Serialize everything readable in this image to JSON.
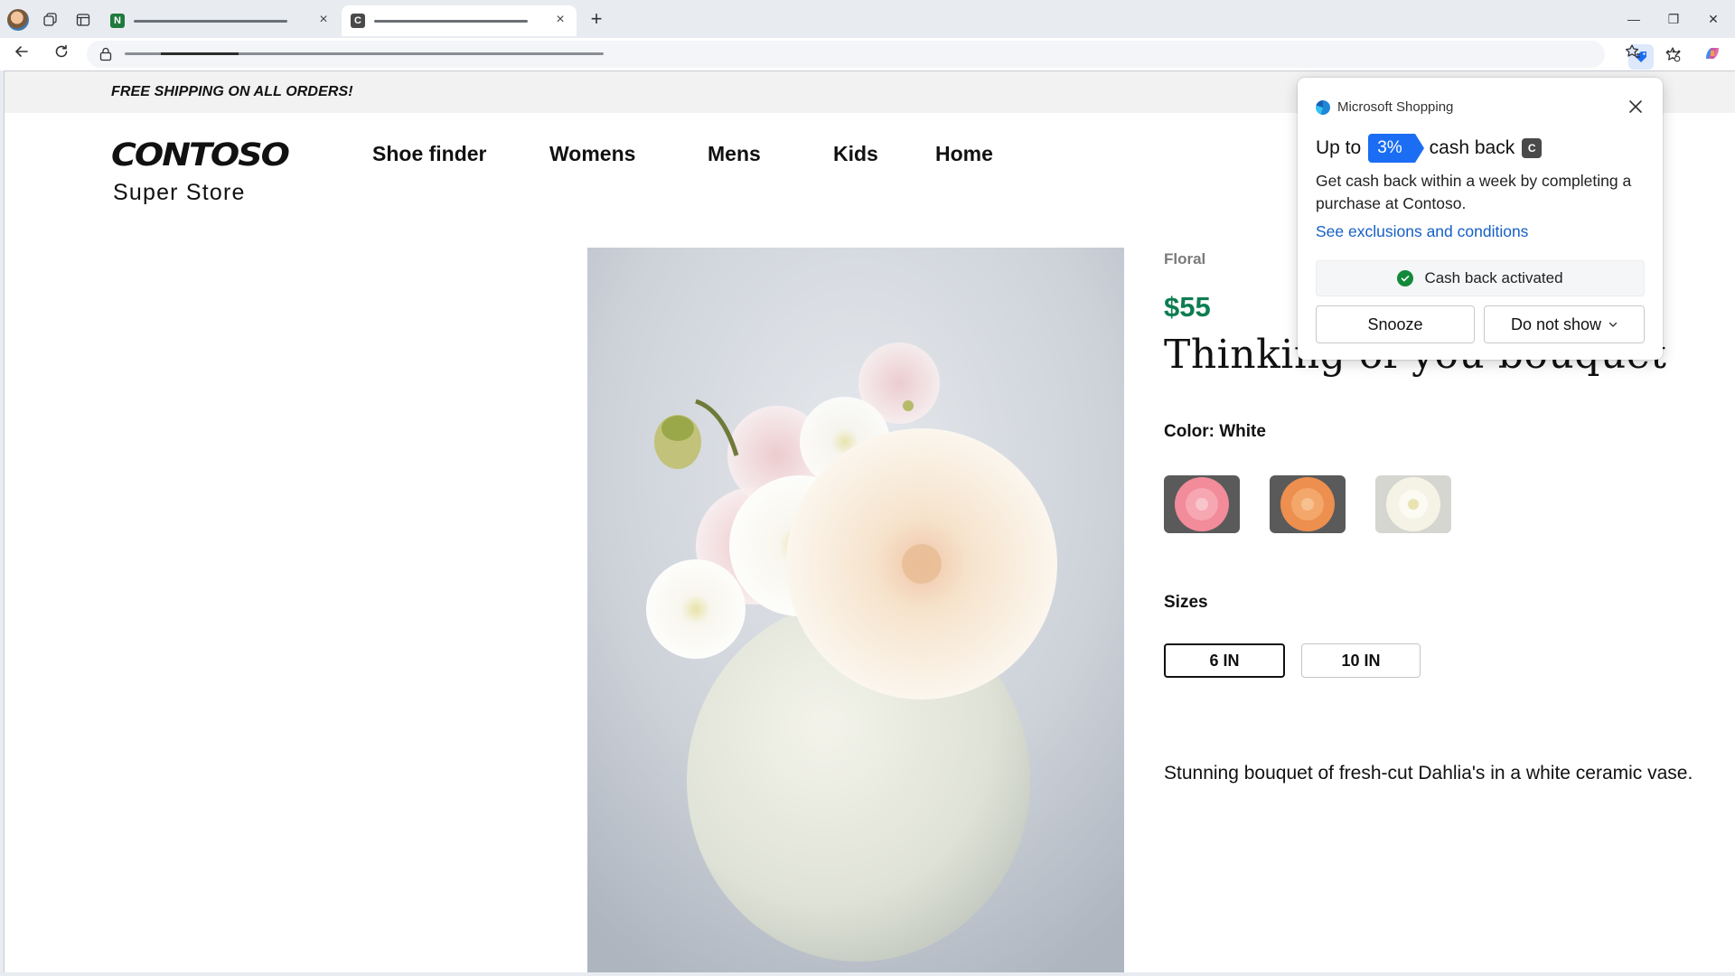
{
  "browser": {
    "tabs": [
      {
        "favicon": "N",
        "favicon_color": "#1f7a3e",
        "close": "×"
      },
      {
        "favicon": "C",
        "favicon_color": "#4a4a4a",
        "close": "×"
      }
    ],
    "new_tab": "+",
    "window_controls": {
      "minimize": "—",
      "restore": "❐",
      "close": "✕"
    }
  },
  "promo": {
    "text": "FREE SHIPPING ON ALL ORDERS!"
  },
  "logo": {
    "brand": "CONTOSO",
    "sub": "Super Store"
  },
  "nav": [
    "Shoe finder",
    "Womens",
    "Mens",
    "Kids",
    "Home"
  ],
  "product": {
    "category": "Floral",
    "price": "$55",
    "title": "Thinking of you bouquet",
    "color_label": "Color: White",
    "sizes_label": "Sizes",
    "sizes": [
      "6 IN",
      "10 IN"
    ],
    "selected_size": "6 IN",
    "description": "Stunning bouquet of fresh-cut Dahlia's in a white ceramic vase."
  },
  "popup": {
    "header": "Microsoft Shopping",
    "up_to": "Up to",
    "percent": "3%",
    "cash_back": "cash back",
    "merchant_icon": "C",
    "description": "Get cash back within a week by completing a purchase at Contoso.",
    "link": "See exclusions and conditions",
    "activated": "Cash back activated",
    "snooze": "Snooze",
    "do_not_show": "Do not show"
  },
  "colors": {
    "price_green": "#0e7d52",
    "popup_badge_blue": "#1b6ef3",
    "link_blue": "#1660c5",
    "check_green": "#128a3a"
  }
}
